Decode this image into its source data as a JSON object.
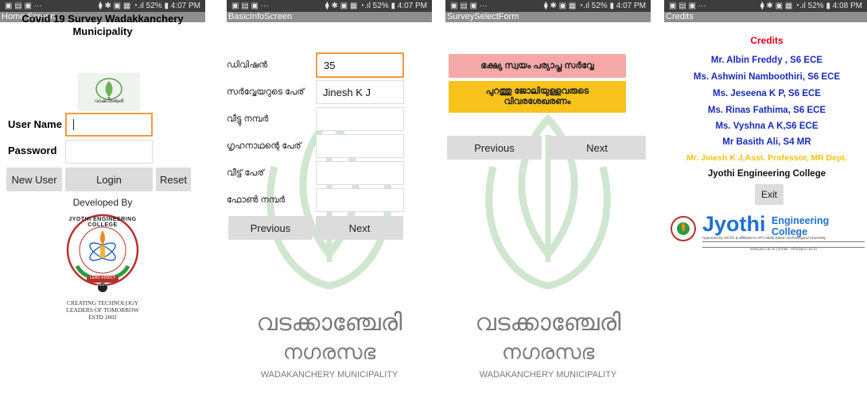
{
  "status": {
    "left_icons": "▣ ▤ ▣ ···",
    "right_icons": "⧫ ✱ ▣ ▦ ◔.ıl",
    "battery": "52%",
    "times": [
      "4:07 PM",
      "4:07 PM",
      "4:07 PM",
      "4:08 PM"
    ]
  },
  "screen1": {
    "title_bar": "Home Screen",
    "heading_line1": "Covid 19 Survey Wadakkanchery",
    "heading_line2": "Municipality",
    "username_label": "User Name",
    "password_label": "Password",
    "username_value": "",
    "password_value": "",
    "new_user_button": "New User",
    "login_button": "Login",
    "reset_button": "Reset",
    "developed_by": "Developed By",
    "college_ring_text": "JYOTHI ENGINEERING COLLEGE",
    "college_motto": "LEAD KINDLY LIGHT",
    "college_tag": "CREATING TECHNOLOGY",
    "college_tag2": "LEADERS OF TOMORROW",
    "college_estd": "ESTD 2002",
    "emblem_text": "വടക്കാഞ്ചേരി"
  },
  "screen2": {
    "title_bar": "BasicInfoScreen",
    "fields": [
      {
        "label": "ഡിവിഷൻ",
        "value": "35"
      },
      {
        "label": "സർവ്വേയറുടെ പേര്",
        "value": "Jinesh K J"
      },
      {
        "label": "വീട്ടു നമ്പർ",
        "value": ""
      },
      {
        "label": "ഗൃഹനാഥന്റെ പേര്",
        "value": ""
      },
      {
        "label": "വീട്ട് പേര്",
        "value": ""
      },
      {
        "label": "ഫോൺ നമ്പർ",
        "value": ""
      }
    ],
    "previous_button": "Previous",
    "next_button": "Next"
  },
  "screen3": {
    "title_bar": "SurveySelectForm",
    "option1": "ഭക്ഷ്യ സ്വയം പര്യാപ്ത സർവ്വേ",
    "option2_line1": "പുറത്തു ജോലിയുള്ളവരുടെ",
    "option2_line2": "വിവരശേഖരണം",
    "previous_button": "Previous",
    "next_button": "Next"
  },
  "watermark": {
    "line1": "വടക്കാഞ്ചേരി",
    "line2": "നഗരസഭ",
    "line3": "WADAKANCHERY MUNICIPALITY"
  },
  "screen4": {
    "title_bar": "Credits",
    "heading": "Credits",
    "credits": [
      "Mr. Albin Freddy , S6 ECE",
      "Ms. Ashwini Namboothiri, S6 ECE",
      "Ms. Jeseena K P, S6 ECE",
      "Ms. Rinas Fathima, S6 ECE",
      "Ms. Vyshna A K,S6 ECE",
      "Mr Basith Ali, S4 MR"
    ],
    "guide": "Mr. Jinesh K J,Asst. Professor, MR Dept.",
    "college": "Jyothi Engineering College",
    "exit_button": "Exit",
    "banner_brand": "Jyothi",
    "banner_suffix": "Engineering College",
    "banner_line": "Approved by AICTE & affiliated to APJ Abdul Kalam Technological University",
    "banner_contact": "www.jecc.ac.in  |  Email : info@jecc.ac.in"
  },
  "colors": {
    "statusbar": "#3d3d3d",
    "titlebar": "#8e8e8e",
    "button": "#dcdcdc",
    "focus": "#f19a3e",
    "option1_bg": "#f4a8a8",
    "option2_bg": "#f8c21c",
    "credits_red": "#e0001b",
    "credits_blue": "#1a2bb8",
    "guide_yellow": "#f4c20d",
    "watermark_green": "#2f8f2f"
  }
}
